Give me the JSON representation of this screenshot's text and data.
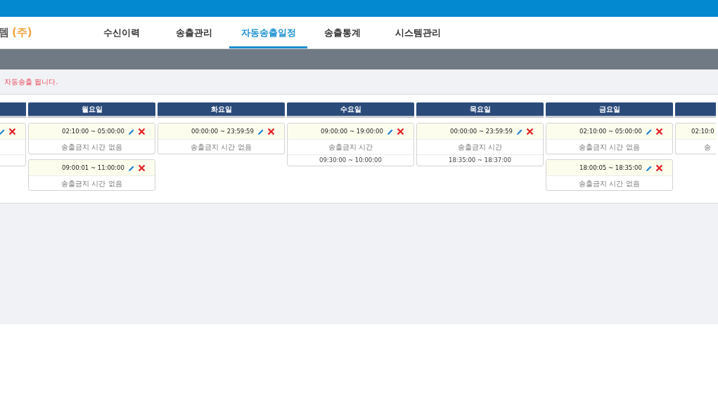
{
  "logo": {
    "text": "템",
    "suffix": "(주)"
  },
  "tabs": [
    {
      "label": "수신이력",
      "selected": false
    },
    {
      "label": "송출관리",
      "selected": false
    },
    {
      "label": "자동송출일정",
      "selected": true
    },
    {
      "label": "송출통계",
      "selected": false
    },
    {
      "label": "시스템관리",
      "selected": false
    }
  ],
  "notice": "자동송출 됩니다.",
  "days": [
    {
      "kind": "cut_left",
      "entries": [
        {
          "restricted": true
        }
      ]
    },
    {
      "title": "월요일",
      "entries": [
        {
          "time": "02:10:00 ~ 05:00:00",
          "restriction": "송출금지 시간 없음",
          "restricted": false
        },
        {
          "time": "09:00:01 ~ 11:00:00",
          "restriction": "송출금지 시간 없음",
          "restricted": false
        }
      ]
    },
    {
      "title": "화요일",
      "entries": [
        {
          "time": "00:00:00 ~ 23:59:59",
          "restriction": "송출금지 시간 없음",
          "restricted": false
        }
      ]
    },
    {
      "title": "수요일",
      "entries": [
        {
          "time": "09:00:00 ~ 19:00:00",
          "restriction": "송출금지 시간",
          "restricted": true,
          "restricted_time": "09:30:00 ~ 10:00:00"
        }
      ]
    },
    {
      "title": "목요일",
      "entries": [
        {
          "time": "00:00:00 ~ 23:59:59",
          "restriction": "송출금지 시간",
          "restricted": true,
          "restricted_time": "18:35:00 ~ 18:37:00"
        }
      ]
    },
    {
      "title": "금요일",
      "entries": [
        {
          "time": "02:10:00 ~ 05:00:00",
          "restriction": "송출금지 시간 없음",
          "restricted": false
        },
        {
          "time": "18:00:05 ~ 18:35:00",
          "restriction": "송출금지 시간 없음",
          "restricted": false
        }
      ]
    },
    {
      "kind": "cut_right",
      "entries": [
        {
          "time": "02:10:0",
          "restriction": "송",
          "restricted": false
        }
      ]
    }
  ]
}
